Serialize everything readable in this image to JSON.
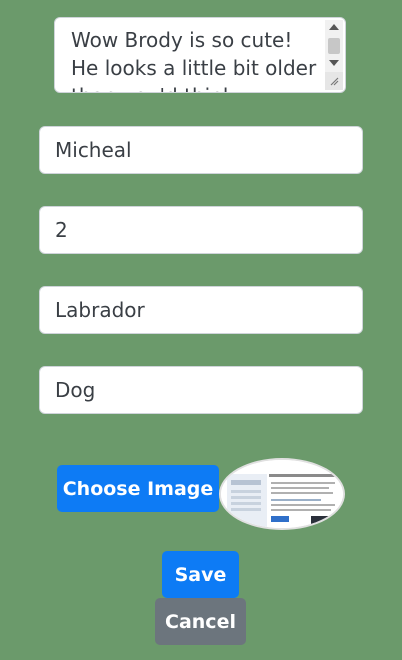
{
  "form": {
    "comment": "Wow Brody is so cute! He looks a little bit older than you'd think",
    "owner_name": "Micheal",
    "age": "2",
    "breed": "Labrador",
    "species": "Dog"
  },
  "image_picker": {
    "choose_label": "Choose Image"
  },
  "actions": {
    "save_label": "Save",
    "cancel_label": "Cancel"
  },
  "colors": {
    "background": "#6b9a6b",
    "primary": "#0d7bf5",
    "secondary": "#6c757d"
  },
  "icons": {
    "scroll_up": "chevron-up-icon",
    "scroll_down": "chevron-down-icon",
    "resize": "resize-grip-icon"
  }
}
